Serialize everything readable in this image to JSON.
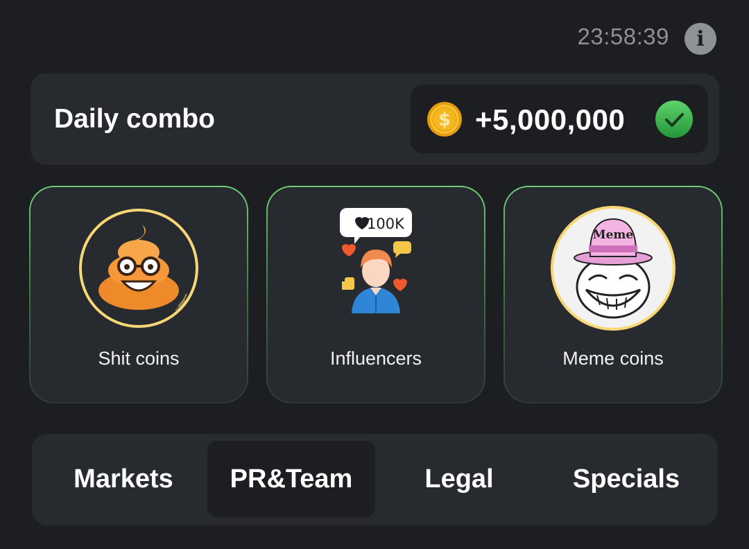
{
  "header": {
    "timer": "23:58:39",
    "info_label": "i"
  },
  "combo": {
    "title": "Daily combo",
    "reward": "+5,000,000",
    "completed": true,
    "coin_color": "#f5b71f",
    "check_color": "#3fbf4f"
  },
  "cards": [
    {
      "label": "Shit coins",
      "icon": "poop-emoji-icon"
    },
    {
      "label": "Influencers",
      "icon": "influencer-icon",
      "likes_badge": "100K"
    },
    {
      "label": "Meme coins",
      "icon": "trollface-meme-icon",
      "hat_text": "Meme"
    }
  ],
  "tabs": [
    {
      "label": "Markets",
      "active": false
    },
    {
      "label": "PR&Team",
      "active": true
    },
    {
      "label": "Legal",
      "active": false
    },
    {
      "label": "Specials",
      "active": false
    }
  ],
  "colors": {
    "background": "#1c1e22",
    "panel": "#272a2f",
    "accent_green": "#6ecf74",
    "ring_gold": "#f7d774"
  }
}
